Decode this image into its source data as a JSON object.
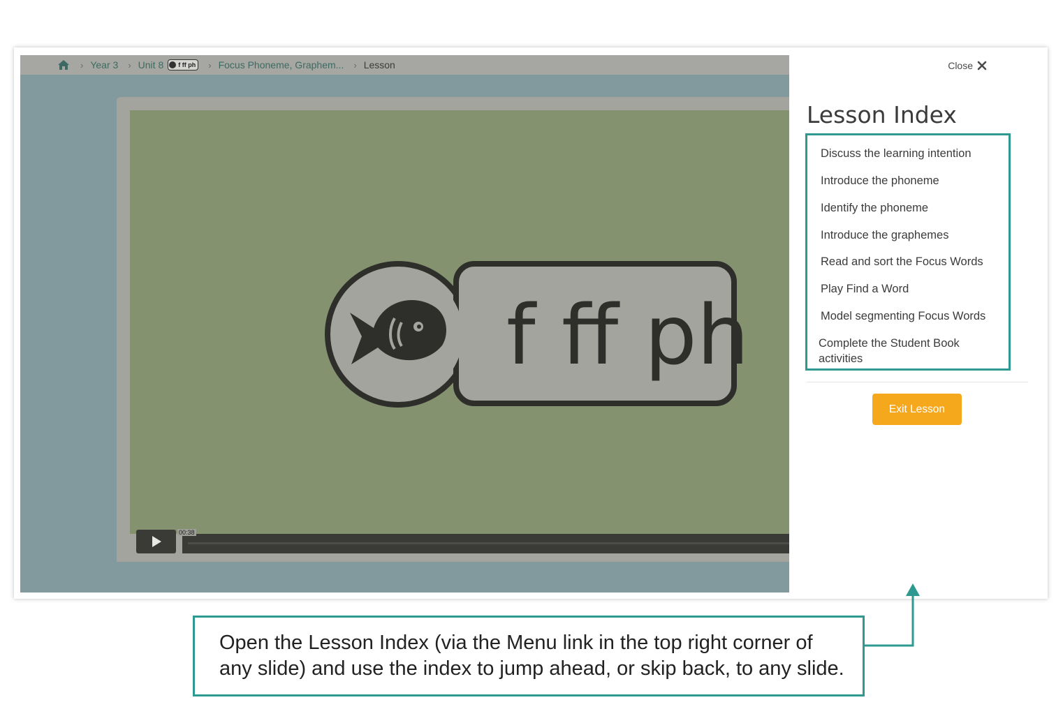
{
  "breadcrumb": {
    "items": [
      "Year 3",
      "Unit 8",
      "Focus Phoneme, Graphem...",
      "Lesson"
    ],
    "unit_badge": "f ff ph"
  },
  "slide": {
    "phoneme_text": "f ff ph",
    "video_time": "00:38"
  },
  "lesson_index": {
    "close_label": "Close",
    "title": "Lesson Index",
    "items": [
      "Discuss the learning intention",
      "Introduce the phoneme",
      "Identify the phoneme",
      "Introduce the graphemes",
      "Read and sort the Focus Words",
      "Play Find a Word",
      "Model segmenting Focus Words",
      "Complete the Student Book activities"
    ],
    "exit_label": "Exit Lesson"
  },
  "callout": {
    "text": "Open the Lesson Index (via the Menu link in the top right corner of any slide) and use the index to jump ahead, or skip back, to any slide."
  },
  "colors": {
    "accent_teal": "#2e9990",
    "exit_button": "#f6a81d",
    "slide_green": "#859270"
  },
  "icons": [
    "home-icon",
    "chevron-right-icon",
    "close-icon",
    "fish-icon",
    "play-icon"
  ]
}
